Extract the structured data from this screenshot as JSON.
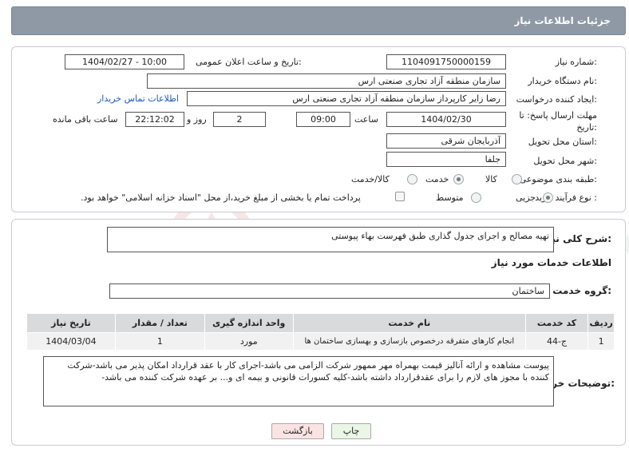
{
  "header": {
    "title": "جزئیات اطلاعات نیاز"
  },
  "form": {
    "need_number_label": "شماره نیاز:",
    "need_number": "1104091750000159",
    "announce_label": "تاریخ و ساعت اعلان عمومی:",
    "announce_value": "1404/02/27 - 10:00",
    "buyer_org_label": "نام دستگاه خریدار:",
    "buyer_org": "سازمان منطقه آزاد تجاری صنعتی ارس",
    "creator_label": "ایجاد کننده درخواست:",
    "creator": "رضا زاير کارپرداز سازمان منطقه آزاد تجاری صنعتی ارس",
    "contact_link": "اطلاعات تماس خریدار",
    "deadline_label": "مهلت ارسال پاسخ: تا تاریخ:",
    "deadline_date": "1404/02/30",
    "time_label": "ساعت",
    "deadline_time": "09:00",
    "days_value": "2",
    "days_label": "روز و",
    "remaining_time": "22:12:02",
    "remaining_label": "ساعت باقی مانده",
    "province_label": "استان محل تحویل:",
    "province": "آذربایجان شرقی",
    "city_label": "شهر محل تحویل:",
    "city": "جلفا",
    "category_label": "طبقه بندی موضوعی:",
    "category_options": [
      "کالا",
      "خدمت",
      "کالا/خدمت"
    ],
    "category_selected": "خدمت",
    "process_label": "نوع فرآیند خرید :",
    "process_options": [
      "جزیی",
      "متوسط"
    ],
    "process_selected": "جزیی",
    "payment_note": "پرداخت تمام یا بخشی از مبلغ خرید،از محل \"اسناد خزانه اسلامی\" خواهد بود."
  },
  "summary": {
    "label": "شرح کلی نیاز:",
    "value": "تهیه مصالح و اجرای جدول گذاری طبق فهرست بهاء پیوستی"
  },
  "services": {
    "section_title": "اطلاعات خدمات مورد نیاز",
    "group_label": "گروه خدمت:",
    "group_value": "ساختمان",
    "columns": [
      "ردیف",
      "کد خدمت",
      "نام خدمت",
      "واحد اندازه گیری",
      "تعداد / مقدار",
      "تاریخ نیاز"
    ],
    "rows": [
      [
        "1",
        "ج-44",
        "انجام کارهای متفرقه درخصوص بازسازی و بهسازی ساختمان ها",
        "مورد",
        "1",
        "1404/03/04"
      ]
    ]
  },
  "buyer_notes": {
    "label": "توضیحات خریدار:",
    "value": "پیوست مشاهده و ارائه آنالیز قیمت بهمراه مهر ممهور شرکت الزامی می باشد-اجرای کار با عقد قرارداد امکان پذیر می باشد-شرکت کننده با مجوز های لازم را برای عقدقرارداد داشته باشد-کلیه کسورات قانونی و بیمه ای و... بر عهده شرکت کننده می باشد-"
  },
  "buttons": {
    "print": "چاپ",
    "back": "بازگشت"
  },
  "colors": {
    "title_bar": "#8f99a6",
    "link": "#1a58c0",
    "back_button": "#fbe3e4",
    "print_button": "#eaf6e6"
  }
}
